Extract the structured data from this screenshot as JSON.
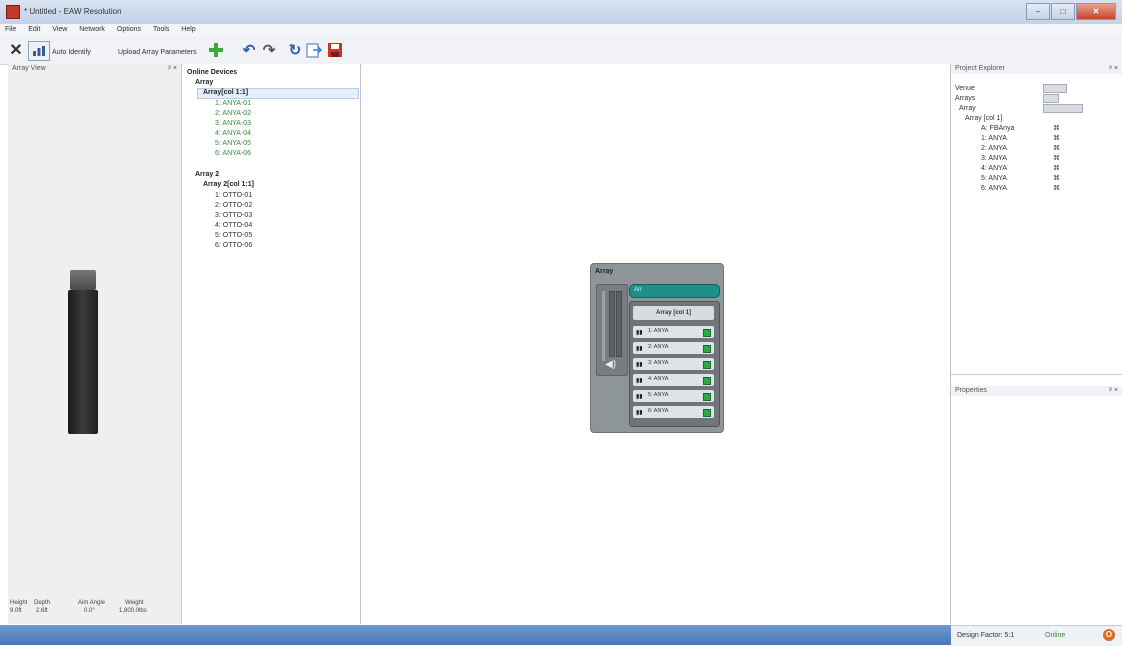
{
  "window": {
    "title": "* Untitled - EAW Resolution",
    "minimize": "–",
    "maximize": "□",
    "close": "✕"
  },
  "menu": [
    "File",
    "Edit",
    "View",
    "Network",
    "Options",
    "Tools",
    "Help"
  ],
  "toolbar": {
    "auto_identify": "Auto Identify",
    "upload": "Upload Array Parameters"
  },
  "array_view": {
    "title": "Array View",
    "stats": [
      {
        "label": "Height",
        "value": "9.0ft"
      },
      {
        "label": "Depth",
        "value": "2.6ft"
      },
      {
        "label": "Aim Angle",
        "value": "0.0°"
      },
      {
        "label": "Weight",
        "value": "1,800.0lbs"
      }
    ]
  },
  "online_devices": {
    "root": "Online Devices",
    "array1": "Array",
    "array1_group": "Array[col 1:1]",
    "array1_items": [
      "1: ANYA-01",
      "2: ANYA-02",
      "3: ANYA-03",
      "4: ANYA-04",
      "5: ANYA-05",
      "6: ANYA-06"
    ],
    "array2": "Array 2",
    "array2_group": "Array 2[col 1:1]",
    "array2_items": [
      "1: OTTO-01",
      "2: OTTO-02",
      "3: OTTO-03",
      "4: OTTO-04",
      "5: OTTO-05",
      "6: OTTO-06"
    ]
  },
  "widget": {
    "title": "Array",
    "teal_label": "Arr",
    "group_title": "Array [col 1]",
    "speakers": [
      "1: ANYA",
      "2: ANYA",
      "3: ANYA",
      "4: ANYA",
      "5: ANYA",
      "6: ANYA"
    ]
  },
  "project_explorer": {
    "title": "Project Explorer",
    "rows": [
      {
        "label": "Venue",
        "indent": 0
      },
      {
        "label": "Arrays",
        "indent": 0
      },
      {
        "label": "Array",
        "indent": 1
      },
      {
        "label": "Array [col 1]",
        "indent": 2
      },
      {
        "label": "A: FBAnya",
        "indent": 3
      },
      {
        "label": "1: ANYA",
        "indent": 3
      },
      {
        "label": "2: ANYA",
        "indent": 3
      },
      {
        "label": "3: ANYA",
        "indent": 3
      },
      {
        "label": "4: ANYA",
        "indent": 3
      },
      {
        "label": "5: ANYA",
        "indent": 3
      },
      {
        "label": "6: ANYA",
        "indent": 3
      }
    ]
  },
  "properties": {
    "title": "Properties"
  },
  "status": {
    "design_factor": "Design Factor: 5:1",
    "online": "Online"
  },
  "colors": {
    "online_green": "#3a8a3a",
    "teal": "#1f8f8a",
    "status_blue": "#4a78b4"
  }
}
